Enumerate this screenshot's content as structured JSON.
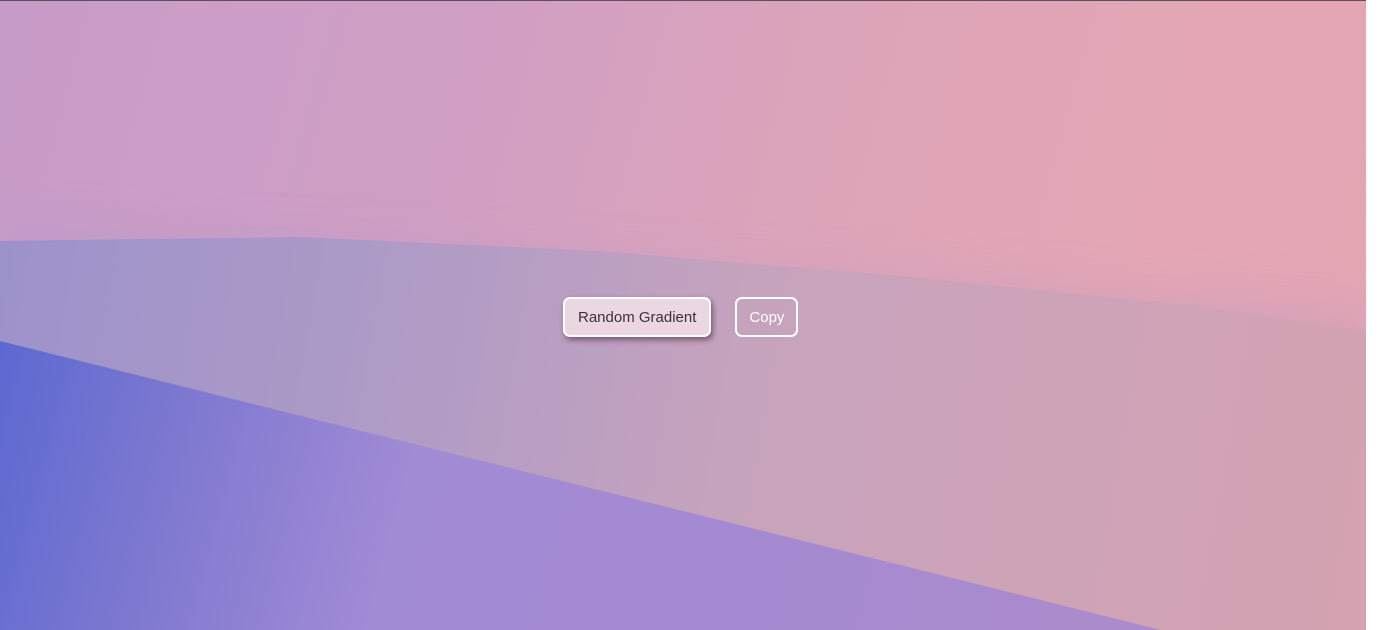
{
  "colors": {
    "top_gradient": [
      "#c89cc9",
      "#e5a5b3"
    ],
    "middle_gradient": [
      "#9a91cb",
      "#d4a2b0"
    ],
    "bottom_gradient": [
      "#4d62d2",
      "#a18bd5",
      "#b090c6"
    ],
    "random_button_bg": "#ead7e2",
    "button_border": "#ffffff"
  },
  "controls": {
    "random_label": "Random Gradient",
    "copy_label": "Copy"
  }
}
